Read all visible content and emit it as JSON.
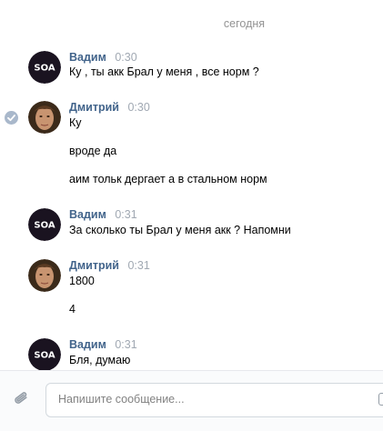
{
  "date_separator": "сегодня",
  "messages": [
    {
      "author": "Вадим",
      "time": "0:30",
      "lines": [
        "Ку , ты акк Брал у меня , все норм ?"
      ]
    },
    {
      "author": "Дмитрий",
      "time": "0:30",
      "lines": [
        "Ку",
        "вроде да",
        "аим тольк дергает а в стальном норм"
      ]
    },
    {
      "author": "Вадим",
      "time": "0:31",
      "lines": [
        "За сколько ты Брал у меня акк ? Напомни"
      ]
    },
    {
      "author": "Дмитрий",
      "time": "0:31",
      "lines": [
        "1800",
        "4"
      ]
    },
    {
      "author": "Вадим",
      "time": "0:31",
      "lines": [
        "Бля, думаю"
      ]
    }
  ],
  "avatar_vadim_logo_text": "SOA",
  "composer": {
    "placeholder": "Напишите сообщение..."
  },
  "colors": {
    "author": "#42648b",
    "time": "#a0a8b2",
    "date": "#939393"
  },
  "icons": {
    "attach": "paperclip-icon",
    "emoji": "emoji-icon",
    "read": "checkmark-icon"
  }
}
